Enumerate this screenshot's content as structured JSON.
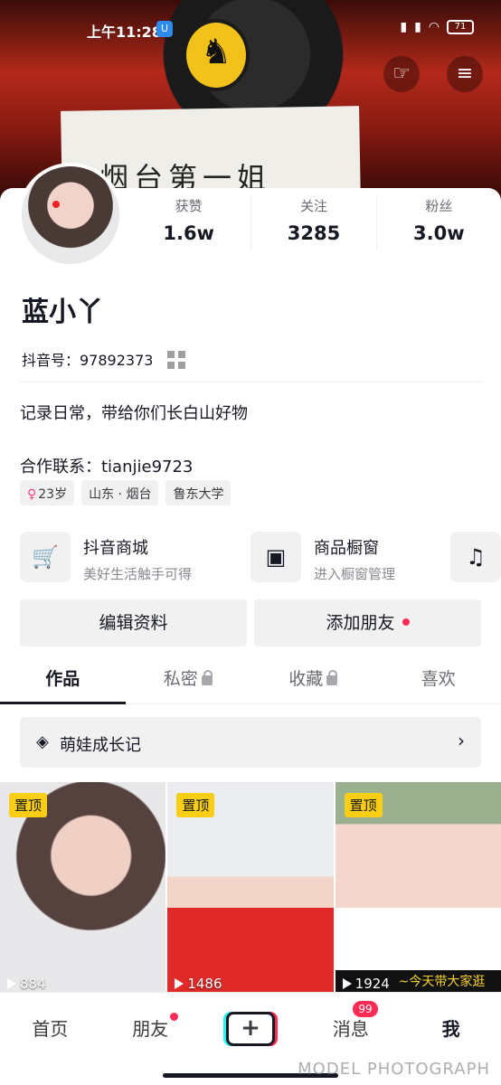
{
  "status": {
    "time": "上午11:28",
    "battery": "71"
  },
  "profile": {
    "stats": [
      {
        "label": "获赞",
        "value": "1.6w"
      },
      {
        "label": "关注",
        "value": "3285"
      },
      {
        "label": "粉丝",
        "value": "3.0w"
      }
    ],
    "name": "蓝小丫",
    "douyin_id": "抖音号：97892373",
    "bio_line1": "记录日常，带给你们长白山好物",
    "bio_line2": "合作联系：tianjie9723",
    "tags": {
      "age": "23岁",
      "location": "山东 · 烟台",
      "school": "鲁东大学"
    },
    "cover_text": "烟台第一姐"
  },
  "services": [
    {
      "title": "抖音商城",
      "subtitle": "美好生活触手可得",
      "icon": "cart-icon"
    },
    {
      "title": "商品橱窗",
      "subtitle": "进入橱窗管理",
      "icon": "shop-icon"
    },
    {
      "icon": "music-icon"
    }
  ],
  "actions": {
    "edit_profile": "编辑资料",
    "add_friends": "添加朋友"
  },
  "tabs": [
    "作品",
    "私密",
    "收藏",
    "喜欢"
  ],
  "collection": {
    "label": "萌娃成长记"
  },
  "videos": [
    {
      "pinned": "置顶",
      "plays": "884"
    },
    {
      "pinned": "置顶",
      "plays": "1486"
    },
    {
      "pinned": "置顶",
      "plays": "1924",
      "caption": "~今天带大家逛"
    }
  ],
  "bottom_nav": {
    "home": "首页",
    "friends": "朋友",
    "create": "+",
    "messages": "消息",
    "messages_badge": "99",
    "me": "我"
  },
  "watermark": "MODEL PHOTOGRAPH"
}
